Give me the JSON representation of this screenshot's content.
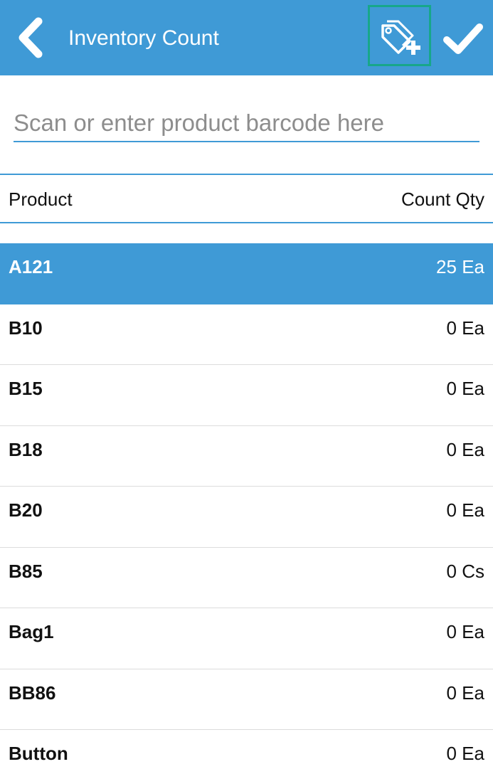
{
  "header": {
    "title": "Inventory Count",
    "accent_color": "#3f9ad6",
    "highlight_color": "#17a78a",
    "icons": [
      "chevron-left-icon",
      "tag-add-icon",
      "checkmark-icon"
    ]
  },
  "search": {
    "placeholder": "Scan or enter product barcode here",
    "value": ""
  },
  "columns": {
    "product": "Product",
    "count_qty": "Count Qty"
  },
  "items": [
    {
      "product": "A121",
      "qty": "25 Ea",
      "selected": true
    },
    {
      "product": "B10",
      "qty": "0 Ea"
    },
    {
      "product": "B15",
      "qty": "0 Ea"
    },
    {
      "product": "B18",
      "qty": "0 Ea"
    },
    {
      "product": "B20",
      "qty": "0 Ea"
    },
    {
      "product": "B85",
      "qty": "0 Cs"
    },
    {
      "product": "Bag1",
      "qty": "0 Ea"
    },
    {
      "product": "BB86",
      "qty": "0 Ea"
    },
    {
      "product": "Button",
      "qty": "0 Ea"
    }
  ]
}
